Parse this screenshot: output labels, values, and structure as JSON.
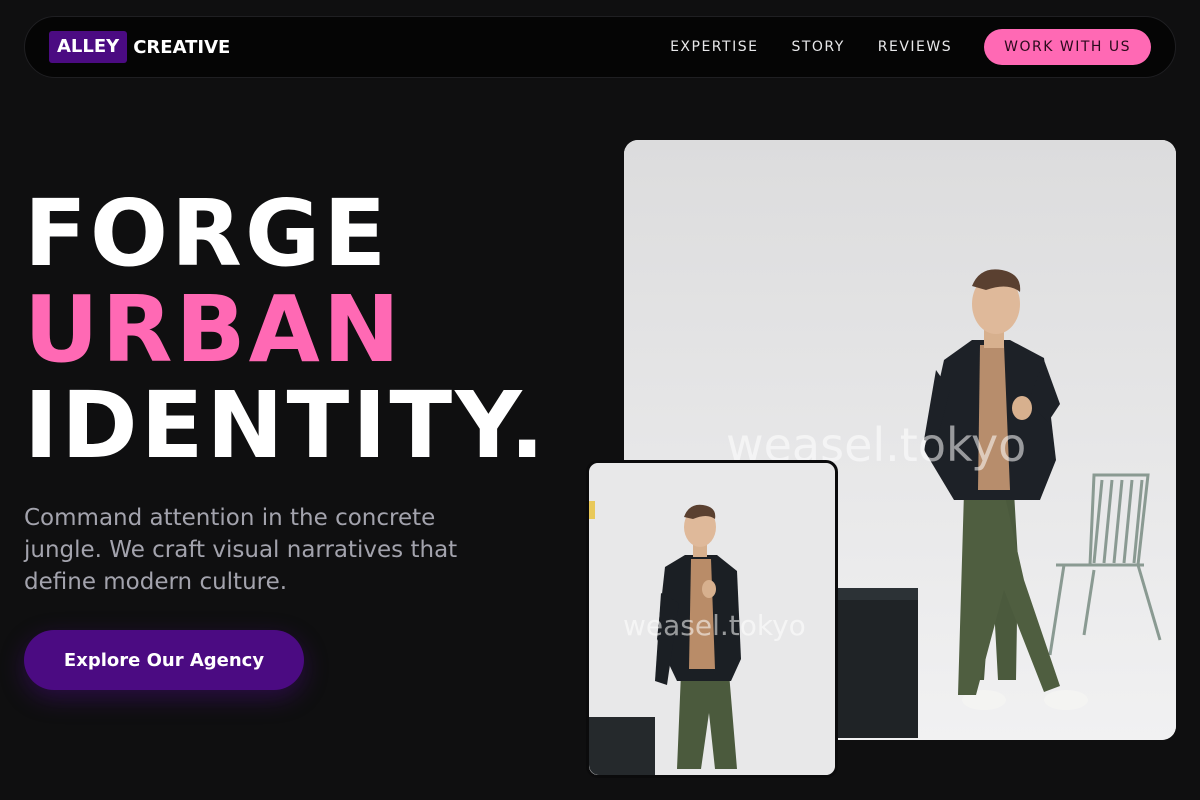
{
  "nav": {
    "logo_box": "ALLEY",
    "logo_word": "CREATIVE",
    "links": [
      "EXPERTISE",
      "STORY",
      "REVIEWS"
    ],
    "cta": "WORK WITH US"
  },
  "hero": {
    "line1": "FORGE",
    "line2": "URBAN",
    "line3": "IDENTITY.",
    "subcopy": "Command attention in the concrete jungle. We craft visual narratives that define modern culture.",
    "cta": "Explore Our Agency"
  },
  "photos": {
    "watermark": "weasel.tokyo"
  },
  "colors": {
    "background": "#0f0f10",
    "accent_pink": "#ff69b4",
    "accent_purple": "#4b0b82",
    "muted_text": "#a3a3ad"
  }
}
